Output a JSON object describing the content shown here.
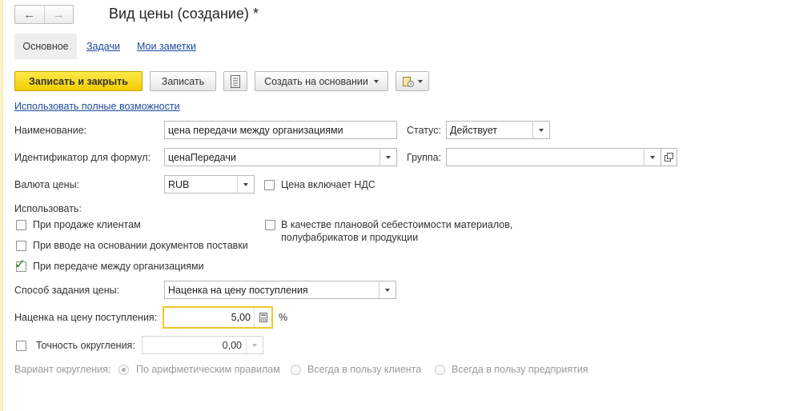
{
  "window": {
    "title": "Вид цены (создание) *",
    "back_icon": "←",
    "forward_icon": "→"
  },
  "tabs": [
    {
      "label": "Основное",
      "active": true
    },
    {
      "label": "Задачи",
      "active": false
    },
    {
      "label": "Мои заметки",
      "active": false
    }
  ],
  "toolbar": {
    "save_close": "Записать и закрыть",
    "save": "Записать",
    "create_based": "Создать на основании"
  },
  "link_full": "Использовать полные возможности",
  "form": {
    "name_label": "Наименование:",
    "name_value": "цена передачи между организациями",
    "status_label": "Статус:",
    "status_value": "Действует",
    "formula_id_label": "Идентификатор для формул:",
    "formula_id_value": "ценаПередачи",
    "group_label": "Группа:",
    "group_value": "",
    "currency_label": "Валюта цены:",
    "currency_value": "RUB",
    "vat_included_label": "Цена включает НДС",
    "vat_included": false,
    "use_label": "Использовать:",
    "use_sale_label": "При продаже клиентам",
    "use_sale": false,
    "use_supply_label": "При вводе на основании документов поставки",
    "use_supply": false,
    "use_transfer_label": "При передаче между организациями",
    "use_transfer": true,
    "use_planned_cost_label_1": "В качестве плановой себестоимости материалов,",
    "use_planned_cost_label_2": "полуфабрикатов и продукции",
    "use_planned_cost": false,
    "price_method_label": "Способ задания цены:",
    "price_method_value": "Наценка на цену поступления",
    "markup_label": "Наценка на цену поступления:",
    "markup_value": "5,00",
    "percent": "%",
    "rounding_precision_label": "Точность округления:",
    "rounding_precision_value": "0,00",
    "rounding_enabled": false,
    "rounding_variant_label": "Вариант округления:",
    "rounding_options": [
      {
        "label": "По арифметическим правилам",
        "selected": true
      },
      {
        "label": "Всегда в пользу клиента",
        "selected": false
      },
      {
        "label": "Всегда в пользу предприятия",
        "selected": false
      }
    ]
  },
  "colors": {
    "primary_button": "#f7d716",
    "link": "#1c4aa0",
    "focus": "#f2c72b",
    "check": "#2d8a2d"
  }
}
